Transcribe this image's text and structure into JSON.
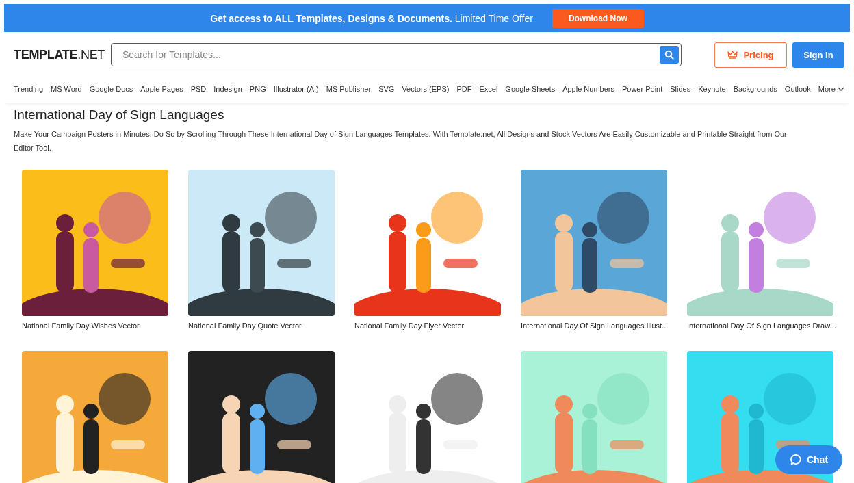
{
  "promo_banner": {
    "text": "**Get access to ALL Templates, Designs & Documents.** Limited Time Offer",
    "button": "Download Now"
  },
  "header": {
    "logo_bold": "TEMPLATE",
    "logo_rest": ".NET",
    "search": {
      "placeholder": "Search for Templates..."
    },
    "pricing": "Pricing",
    "sign_in": "Sign in"
  },
  "nav": {
    "items": [
      "Trending",
      "MS Word",
      "Google Docs",
      "Apple Pages",
      "PSD",
      "Indesign",
      "PNG",
      "Illustrator (AI)",
      "MS Publisher",
      "SVG",
      "Vectors (EPS)",
      "PDF",
      "Excel",
      "Google Sheets",
      "Apple Numbers",
      "Power Point",
      "Slides",
      "Keynote",
      "Backgrounds",
      "Outlook"
    ],
    "more": "More"
  },
  "page": {
    "title": "International Day of Sign Languages",
    "description": "Make Your Campaign Posters in Minutes. Do So by Scrolling Through These International Day of Sign Languages Templates. With Template.net, All Designs and Stock Vectors Are Easily Customizable and Printable Straight from Our Editor Tool."
  },
  "templates": [
    {
      "kind": "picture",
      "caption": "National Family Day Wishes Vector"
    },
    {
      "kind": "picture",
      "caption": "National Family Day Quote Vector"
    },
    {
      "kind": "picture",
      "caption": "National Family Day Flyer Vector"
    },
    {
      "kind": "picture",
      "caption": "International Day Of Sign Languages Illust..."
    },
    {
      "kind": "picture",
      "caption": "International Day Of Sign Languages Draw..."
    },
    {
      "kind": "picture"
    },
    {
      "kind": "picture"
    },
    {
      "kind": "picture"
    },
    {
      "kind": "picture"
    },
    {
      "kind": "picture"
    }
  ],
  "chat_button": "Chat"
}
